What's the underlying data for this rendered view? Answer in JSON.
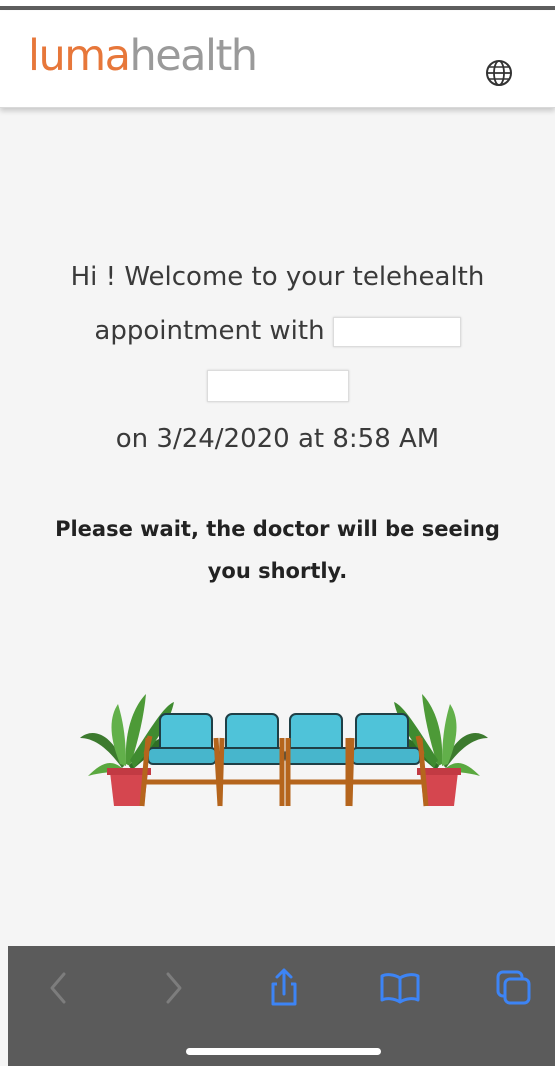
{
  "header": {
    "logo_part1": "luma",
    "logo_part2": "health",
    "language_icon": "globe-icon"
  },
  "main": {
    "welcome_line1": "Hi ! Welcome to your telehealth",
    "welcome_line2": "appointment with",
    "appointment_time": "on 3/24/2020 at 8:58 AM",
    "wait_line1": "Please wait, the doctor will be seeing",
    "wait_line2": "you shortly.",
    "illustration": "waiting-room-chairs-illustration"
  },
  "browser_toolbar": {
    "icons": [
      "back-icon",
      "forward-icon",
      "share-icon",
      "bookmarks-icon",
      "tabs-icon"
    ]
  },
  "colors": {
    "brand_orange": "#e7773a",
    "logo_gray": "#9a9a9a",
    "toolbar_bg": "#5b5b5b",
    "toolbar_icon_active": "#3d84f5",
    "toolbar_icon_disabled": "#7d7d7d",
    "chair_cushion": "#4fc3d9",
    "chair_frame": "#b5651d",
    "pot": "#d5464f"
  }
}
